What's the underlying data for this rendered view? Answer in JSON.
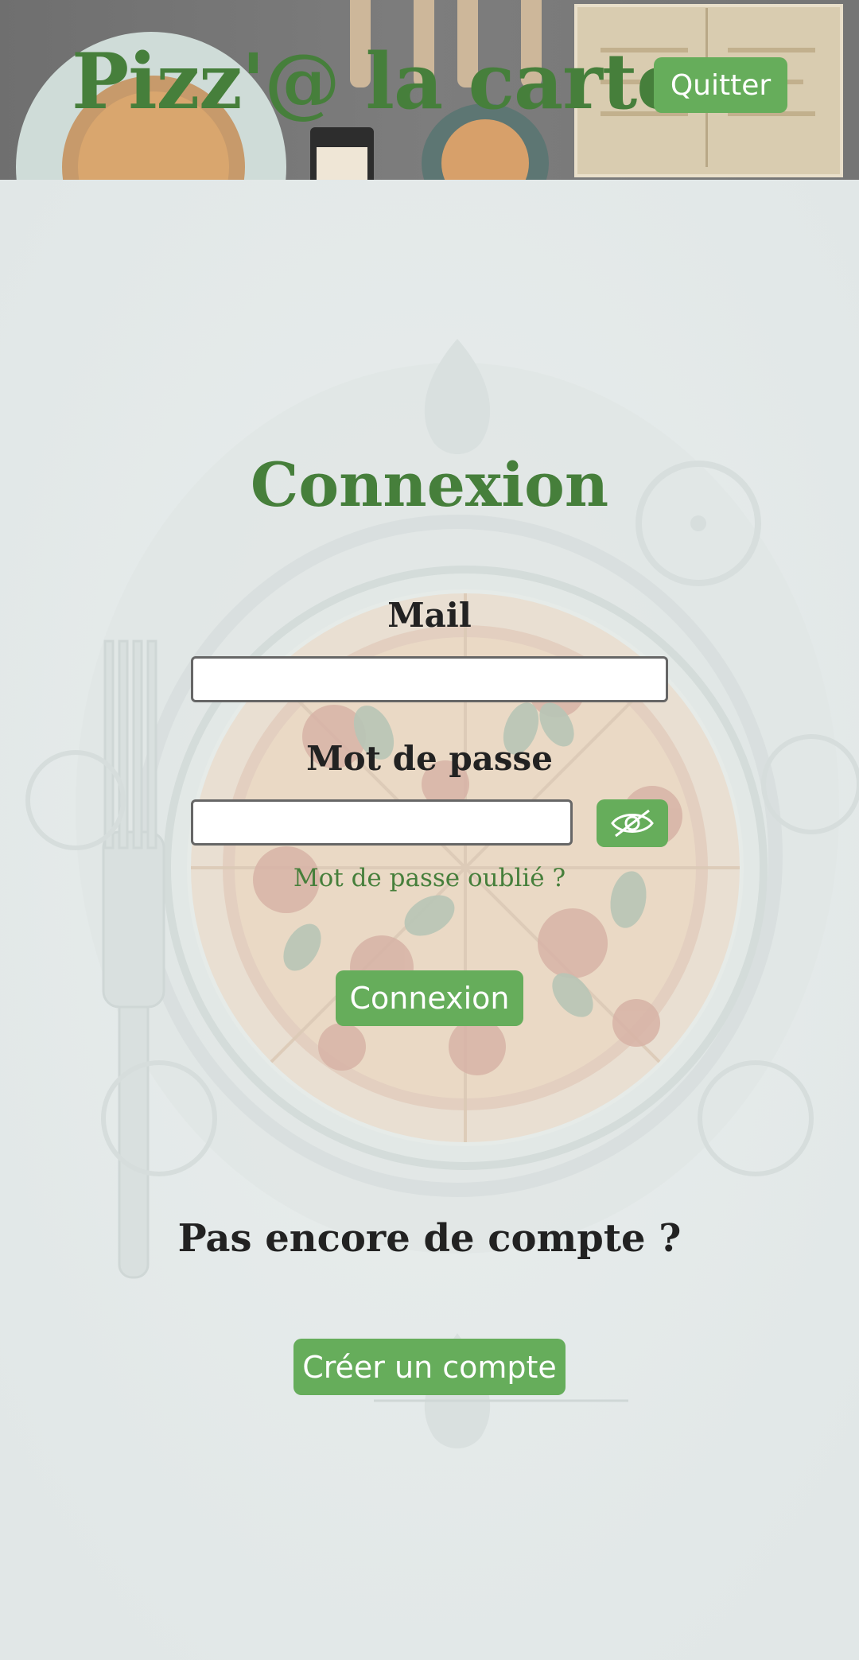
{
  "header": {
    "title": "Pizz'@ la carte",
    "quit_label": "Quitter"
  },
  "login_form": {
    "heading": "Connexion",
    "email_label": "Mail",
    "email_value": "",
    "password_label": "Mot de passe",
    "password_value": "",
    "toggle_icon": "eye-slash-icon",
    "forgot_link": "Mot de passe oublié ?",
    "submit_label": "Connexion"
  },
  "signup": {
    "prompt": "Pas encore de compte ?",
    "create_label": "Créer un compte"
  },
  "colors": {
    "brand_green": "#467f3b",
    "button_green": "#66ad5b",
    "background": "#e4eaea",
    "text_dark": "#222222"
  }
}
